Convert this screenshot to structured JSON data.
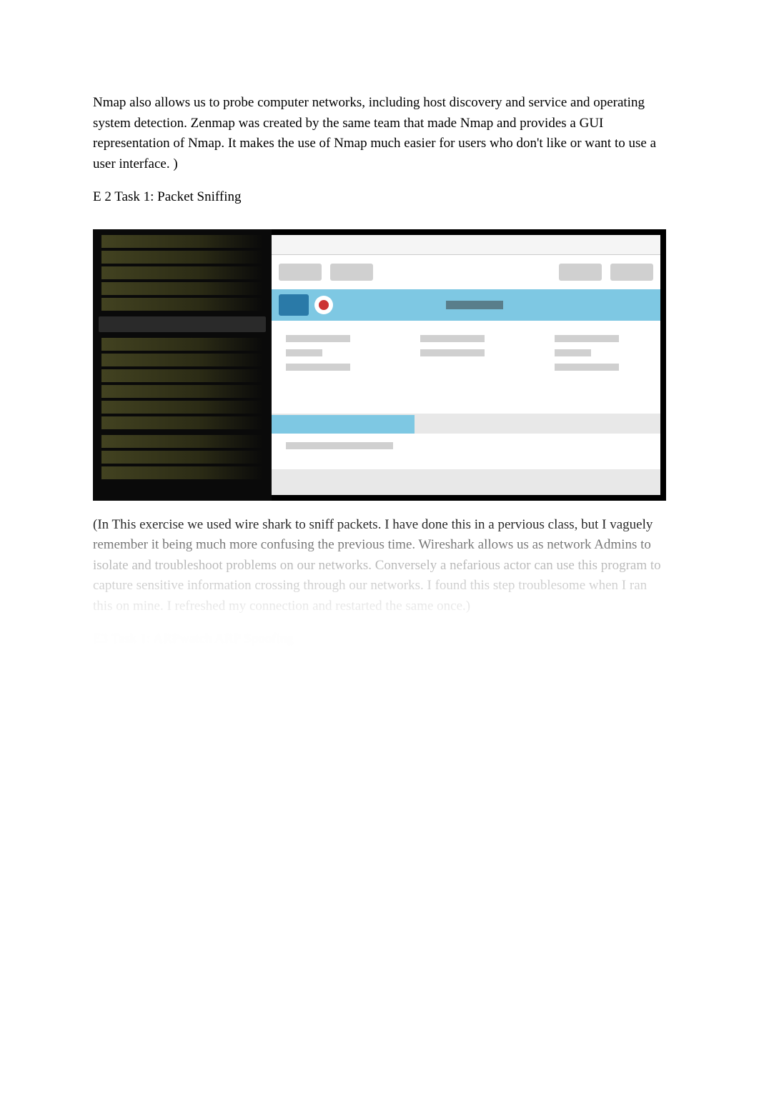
{
  "content": {
    "paragraph1": "Nmap also allows us to probe computer networks, including host discovery and service and operating system detection. Zenmap was created by the same team that made Nmap and provides a GUI representation of Nmap. It makes the use of Nmap much easier for users who don't like or want to use a user interface. )",
    "heading1": "E 2 Task 1: Packet Sniffing",
    "paragraph2": " (In This exercise we used wire shark to sniff packets. I have done this in a pervious class, but I vaguely remember it being much more confusing the previous time.   Wireshark allows us as network Admins to isolate and troubleshoot problems on our networks. Conversely a nefarious actor can use this program to capture sensitive information crossing through our networks. I found this step troublesome when I ran this on mine. I refreshed my connection and restarted the same once.)",
    "heading2": "E3 Task 1: ARPwatch ARP Spoofing"
  }
}
